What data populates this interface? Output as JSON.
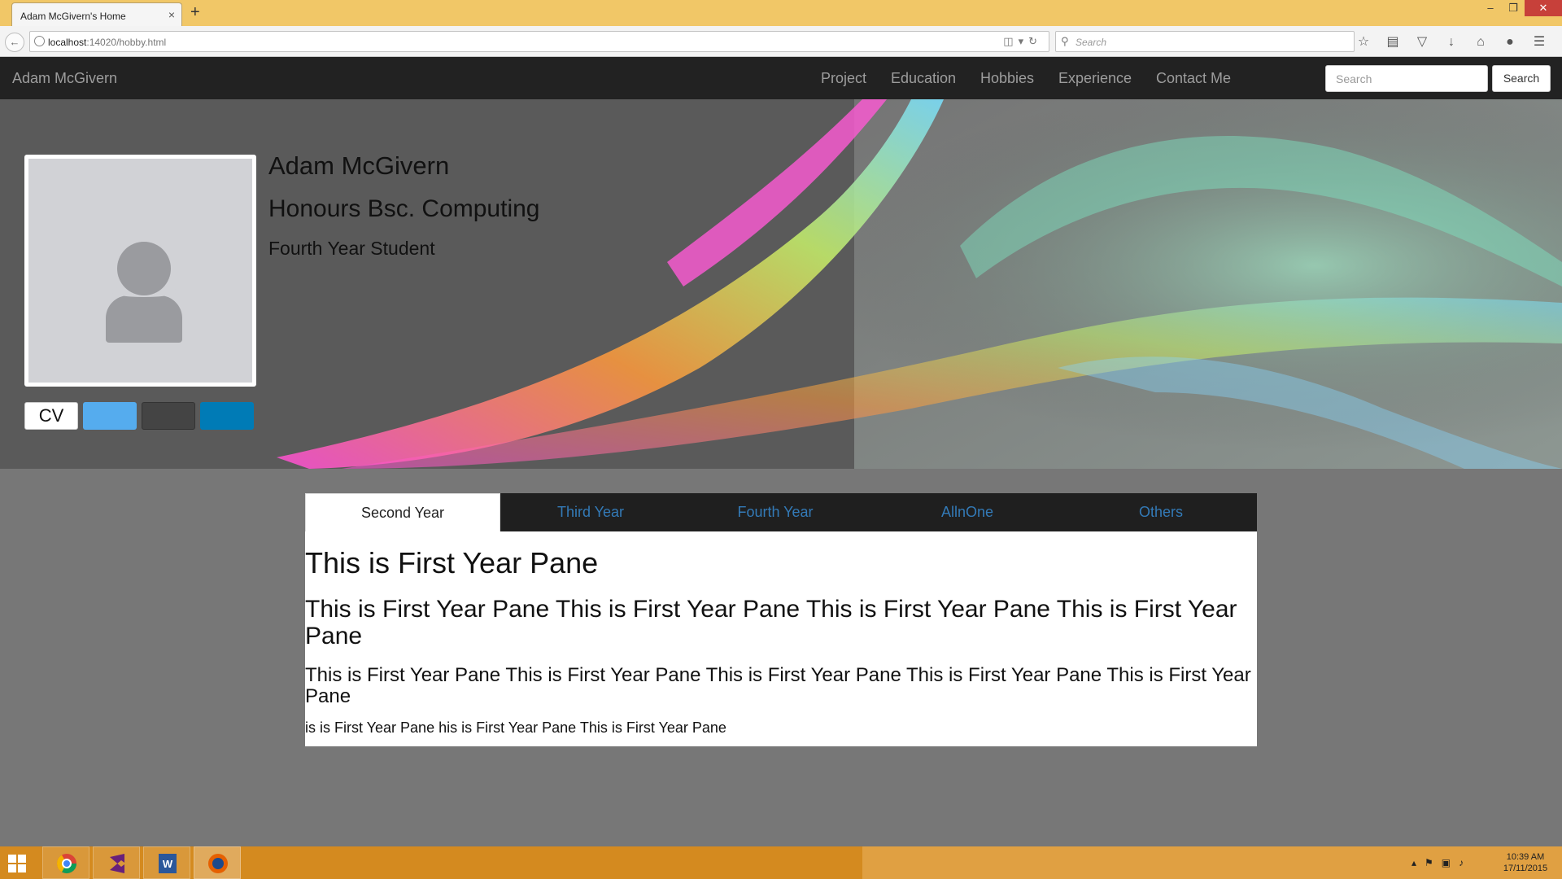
{
  "browser": {
    "tab_title": "Adam McGivern's Home",
    "tab_close": "×",
    "new_tab": "+",
    "window_controls": {
      "minimize": "–",
      "restore": "❐",
      "close": "✕"
    },
    "url_host": "localhost",
    "url_path": ":14020/hobby.html",
    "search_placeholder": "Search",
    "toolbar_icons": [
      "star-icon",
      "bookmarks-icon",
      "pocket-icon",
      "download-icon",
      "home-icon",
      "chat-icon",
      "menu-icon"
    ]
  },
  "site_nav": {
    "brand": "Adam McGivern",
    "links": [
      "Project",
      "Education",
      "Hobbies",
      "Experience",
      "Contact Me"
    ],
    "search_placeholder": "Search",
    "search_button": "Search"
  },
  "hero": {
    "name": "Adam McGivern",
    "degree": "Honours Bsc. Computing",
    "year": "Fourth Year Student",
    "cv_button": "CV",
    "colors": {
      "twitter": "#55acee",
      "github": "#444444",
      "linkedin": "#007bb6"
    }
  },
  "tabs": {
    "items": [
      "Second Year",
      "Third Year",
      "Fourth Year",
      "AllnOne",
      "Others"
    ],
    "active": "Second Year"
  },
  "pane": {
    "heading1": "This is First Year Pane",
    "heading2": "This is First Year Pane This is First Year Pane This is First Year Pane This is First Year Pane",
    "heading3": "This is First Year Pane This is First Year Pane This is First Year Pane This is First Year Pane This is First Year Pane",
    "paragraph": "is is First Year Pane his is First Year Pane This is First Year Pane"
  },
  "taskbar": {
    "apps": [
      "chrome-icon",
      "visual-studio-icon",
      "word-icon",
      "firefox-icon"
    ],
    "clock_time": "10:39 AM",
    "clock_date": "17/11/2015"
  }
}
